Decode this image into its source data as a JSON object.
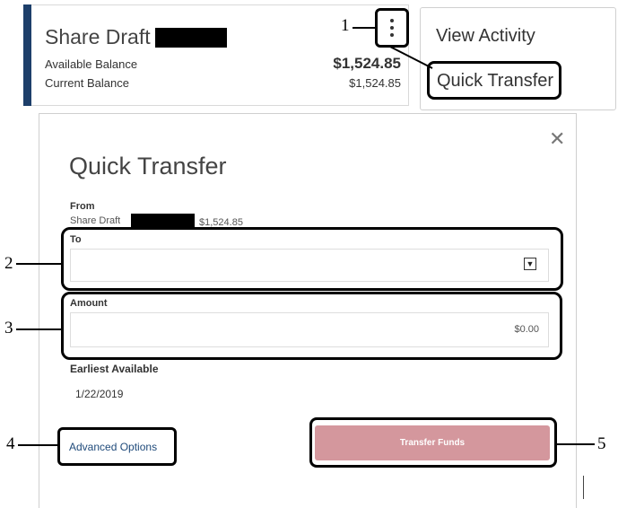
{
  "account_card": {
    "name": "Share Draft",
    "available_label": "Available Balance",
    "available_value": "$1,524.85",
    "current_label": "Current Balance",
    "current_value": "$1,524.85",
    "menu_icon": "kebab-menu-icon"
  },
  "menu": {
    "view_activity": "View Activity",
    "quick_transfer": "Quick Transfer"
  },
  "modal": {
    "title": "Quick Transfer",
    "close_icon": "close-icon",
    "from_label": "From",
    "from_account": "Share Draft",
    "from_balance": "$1,524.85",
    "to_label": "To",
    "to_value": "",
    "amount_label": "Amount",
    "amount_placeholder": "$0.00",
    "earliest_label": "Earliest Available",
    "earliest_value": "1/22/2019",
    "advanced_options": "Advanced Options",
    "transfer_button": "Transfer Funds"
  },
  "callouts": [
    "1",
    "2",
    "3",
    "4",
    "5"
  ],
  "colors": {
    "stripe": "#1d3f6a",
    "transfer_button": "#d4979d",
    "link": "#1f4a7a"
  }
}
